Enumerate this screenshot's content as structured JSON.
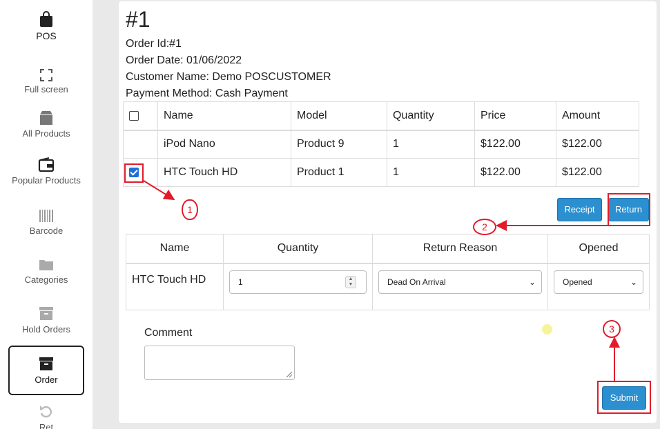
{
  "sidebar": {
    "items": [
      {
        "label": "POS",
        "icon": "shopping-bag-icon"
      },
      {
        "label": "Full screen",
        "icon": "fullscreen-icon"
      },
      {
        "label": "All Products",
        "icon": "box-icon"
      },
      {
        "label": "Popular Products",
        "icon": "wallet-icon"
      },
      {
        "label": "Barcode",
        "icon": "barcode-icon"
      },
      {
        "label": "Categories",
        "icon": "folder-icon"
      },
      {
        "label": "Hold Orders",
        "icon": "archive-icon"
      },
      {
        "label": "Order",
        "icon": "archive-box-icon"
      },
      {
        "label": "Ret",
        "icon": "undo-icon"
      }
    ]
  },
  "order": {
    "title": "#1",
    "id_line": "Order Id:#1",
    "date_line": "Order Date: 01/06/2022",
    "customer_line": "Customer Name: Demo POSCUSTOMER",
    "payment_line": "Payment Method: Cash Payment"
  },
  "items_table": {
    "headers": [
      "Name",
      "Model",
      "Quantity",
      "Price",
      "Amount"
    ],
    "rows": [
      {
        "checked": false,
        "name": "iPod Nano",
        "model": "Product 9",
        "quantity": "1",
        "price": "$122.00",
        "amount": "$122.00"
      },
      {
        "checked": true,
        "name": "HTC Touch HD",
        "model": "Product 1",
        "quantity": "1",
        "price": "$122.00",
        "amount": "$122.00"
      }
    ]
  },
  "buttons": {
    "receipt": "Receipt",
    "return": "Return",
    "submit": "Submit"
  },
  "return_table": {
    "headers": [
      "Name",
      "Quantity",
      "Return Reason",
      "Opened"
    ],
    "row": {
      "name": "HTC Touch HD",
      "quantity": "1",
      "reason": "Dead On Arrival",
      "opened": "Opened"
    }
  },
  "comment": {
    "label": "Comment",
    "value": ""
  },
  "annotations": {
    "one": "1",
    "two": "2",
    "three": "3",
    "color": "#e11b2a"
  },
  "colors": {
    "primary_button": "#2b8fd0",
    "checkbox": "#1f6fd6"
  }
}
